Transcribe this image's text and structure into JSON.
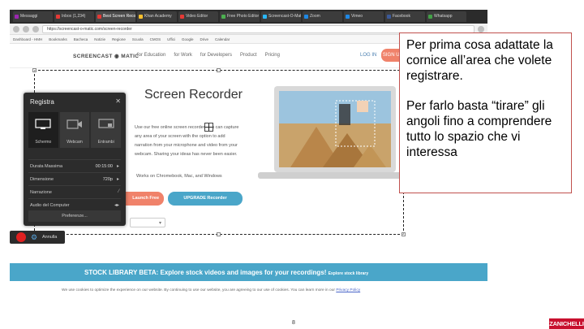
{
  "browser": {
    "tabs": [
      {
        "label": "Messaggi",
        "color": "#9c27b0"
      },
      {
        "label": "Inbox (1,234)",
        "color": "#e53935"
      },
      {
        "label": "Best Screen Recorder",
        "color": "#e53935"
      },
      {
        "label": "Khan Academy",
        "color": "#fbc02d"
      },
      {
        "label": "Video Editor",
        "color": "#e53935"
      },
      {
        "label": "Free Photo Editor",
        "color": "#4caf50"
      },
      {
        "label": "Screencast-O-Matic",
        "color": "#29b6f6"
      },
      {
        "label": "Zoom",
        "color": "#1e88e5"
      },
      {
        "label": "Vimeo",
        "color": "#1e88e5"
      },
      {
        "label": "Facebook",
        "color": "#3b5998"
      },
      {
        "label": "Whatsapp",
        "color": "#43a047"
      }
    ],
    "url": "https://screencast-o-matic.com/screen-recorder",
    "bookmarks": [
      "Dashboard - HMH",
      "Bookmarks",
      "Bacheca",
      "Notizie",
      "Regione",
      "Scuola",
      "CMOS",
      "Uffici",
      "Google",
      "Drive",
      "Calendar"
    ]
  },
  "site": {
    "logo": "SCREENCAST ◉ MATIC",
    "nav": [
      "for Education",
      "for Work",
      "for Developers",
      "Product",
      "Pricing"
    ],
    "login": "LOG IN",
    "signup": "SIGN UP FREE",
    "hero_title": "Screen Recorder",
    "hero_text": "Use our free online screen recorder, you can capture any area of your screen with the option to add narration from your microphone and video from your webcam. Sharing your ideas has never been easier.",
    "platforms": "Works on Chromebook, Mac, and Windows",
    "cta_primary": "Launch Free Recorder",
    "cta_secondary": "UPGRADE Recorder",
    "banner_main": "STOCK LIBRARY BETA: Explore stock videos and images for your recordings!",
    "banner_link": "Explore stock library",
    "cookie_text": "We use cookies to optimize the experience on our website. By continuing to use our website, you are agreeing to our use of cookies. You can learn more in our",
    "cookie_link": "Privacy Policy"
  },
  "recorder": {
    "title": "Registra",
    "modes": [
      "Schermo",
      "Webcam",
      "Entrambi"
    ],
    "rows": [
      {
        "label": "Durata Massima",
        "value": "00:15:00",
        "icon": "▸"
      },
      {
        "label": "Dimensione",
        "value": "720p",
        "icon": "▸"
      },
      {
        "label": "Narrazione",
        "value": "",
        "icon": "⁄"
      },
      {
        "label": "Audio del Computer",
        "value": "",
        "icon": "◂▸"
      }
    ],
    "preferences": "Preferenze...",
    "cancel": "Annulla"
  },
  "note": {
    "p1": "Per prima cosa adattate la cornice all’area che volete registrare.",
    "p2": "Per farlo basta “tirare” gli angoli fino a comprendere tutto lo spazio che vi interessa"
  },
  "slide": {
    "page": "8",
    "brand": "ZANICHELLI",
    "brand_color": "#c8102e"
  }
}
